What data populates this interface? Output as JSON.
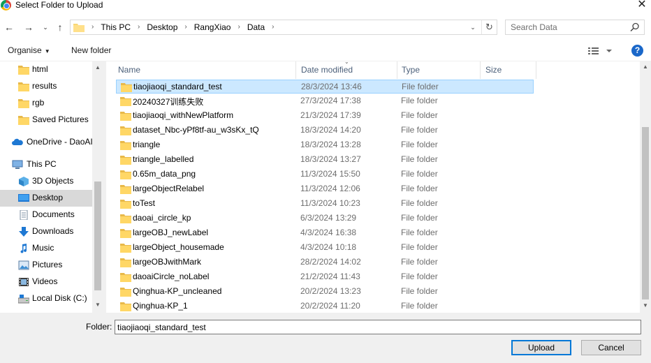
{
  "window": {
    "title": "Select Folder to Upload",
    "close_glyph": "✕"
  },
  "nav": {
    "back_glyph": "←",
    "forward_glyph": "→",
    "recent_glyph": "⌄",
    "up_glyph": "↑"
  },
  "address": {
    "crumbs": [
      "This PC",
      "Desktop",
      "RangXiao",
      "Data"
    ],
    "separator": "›",
    "dropdown_glyph": "⌄",
    "refresh_glyph": "↻"
  },
  "search": {
    "placeholder": "Search Data"
  },
  "toolbar": {
    "organise_label": "Organise",
    "new_folder_label": "New folder",
    "help_glyph": "?"
  },
  "sidebar": {
    "items": [
      {
        "label": "html",
        "icon": "folder-icon"
      },
      {
        "label": "results",
        "icon": "folder-icon"
      },
      {
        "label": "rgb",
        "icon": "folder-icon"
      },
      {
        "label": "Saved Pictures",
        "icon": "folder-icon"
      },
      {
        "label": "OneDrive - DaoAI",
        "icon": "cloud-icon"
      },
      {
        "label": "This PC",
        "icon": "computer-icon"
      },
      {
        "label": "3D Objects",
        "icon": "cube-icon"
      },
      {
        "label": "Desktop",
        "icon": "desktop-icon"
      },
      {
        "label": "Documents",
        "icon": "document-icon"
      },
      {
        "label": "Downloads",
        "icon": "download-icon"
      },
      {
        "label": "Music",
        "icon": "music-icon"
      },
      {
        "label": "Pictures",
        "icon": "picture-icon"
      },
      {
        "label": "Videos",
        "icon": "video-icon"
      },
      {
        "label": "Local Disk (C:)",
        "icon": "drive-icon"
      }
    ]
  },
  "columns": {
    "name": "Name",
    "date": "Date modified",
    "type": "Type",
    "size": "Size"
  },
  "files": [
    {
      "name": "tiaojiaoqi_standard_test",
      "date": "28/3/2024 13:46",
      "type": "File folder"
    },
    {
      "name": "20240327训练失败",
      "date": "27/3/2024 17:38",
      "type": "File folder"
    },
    {
      "name": "tiaojiaoqi_withNewPlatform",
      "date": "21/3/2024 17:39",
      "type": "File folder"
    },
    {
      "name": "dataset_Nbc-yPf8tf-au_w3sKx_tQ",
      "date": "18/3/2024 14:20",
      "type": "File folder"
    },
    {
      "name": "triangle",
      "date": "18/3/2024 13:28",
      "type": "File folder"
    },
    {
      "name": "triangle_labelled",
      "date": "18/3/2024 13:27",
      "type": "File folder"
    },
    {
      "name": "0.65m_data_png",
      "date": "11/3/2024 15:50",
      "type": "File folder"
    },
    {
      "name": "largeObjectRelabel",
      "date": "11/3/2024 12:06",
      "type": "File folder"
    },
    {
      "name": "toTest",
      "date": "11/3/2024 10:23",
      "type": "File folder"
    },
    {
      "name": "daoai_circle_kp",
      "date": "6/3/2024 13:29",
      "type": "File folder"
    },
    {
      "name": "largeOBJ_newLabel",
      "date": "4/3/2024 16:38",
      "type": "File folder"
    },
    {
      "name": "largeObject_housemade",
      "date": "4/3/2024 10:18",
      "type": "File folder"
    },
    {
      "name": "largeOBJwithMark",
      "date": "28/2/2024 14:02",
      "type": "File folder"
    },
    {
      "name": "daoaiCircle_noLabel",
      "date": "21/2/2024 11:43",
      "type": "File folder"
    },
    {
      "name": "Qinghua-KP_uncleaned",
      "date": "20/2/2024 13:23",
      "type": "File folder"
    },
    {
      "name": "Qinghua-KP_1",
      "date": "20/2/2024 11:20",
      "type": "File folder"
    }
  ],
  "footer": {
    "folder_label": "Folder:",
    "folder_value": "tiaojiaoqi_standard_test",
    "upload_label": "Upload",
    "cancel_label": "Cancel"
  },
  "scroll_glyphs": {
    "up": "▲",
    "down": "▼"
  }
}
